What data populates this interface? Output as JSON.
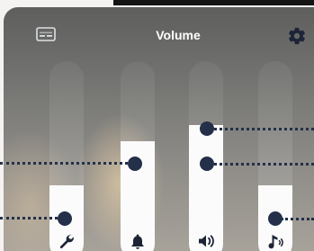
{
  "window": {
    "title": "Volume"
  },
  "icons": {
    "caption": "caption-icon",
    "settings": "gear-icon"
  },
  "sliders": [
    {
      "name": "system",
      "icon": "wrench-icon",
      "level": 0.38
    },
    {
      "name": "notifications",
      "icon": "bell-icon",
      "level": 0.6
    },
    {
      "name": "media",
      "icon": "speaker-icon",
      "level": 0.68
    },
    {
      "name": "ringtone",
      "icon": "music-note-icon",
      "level": 0.38
    }
  ],
  "colors": {
    "knob": "#243049",
    "fill": "#fbfbfb",
    "title": "#ffffff"
  }
}
